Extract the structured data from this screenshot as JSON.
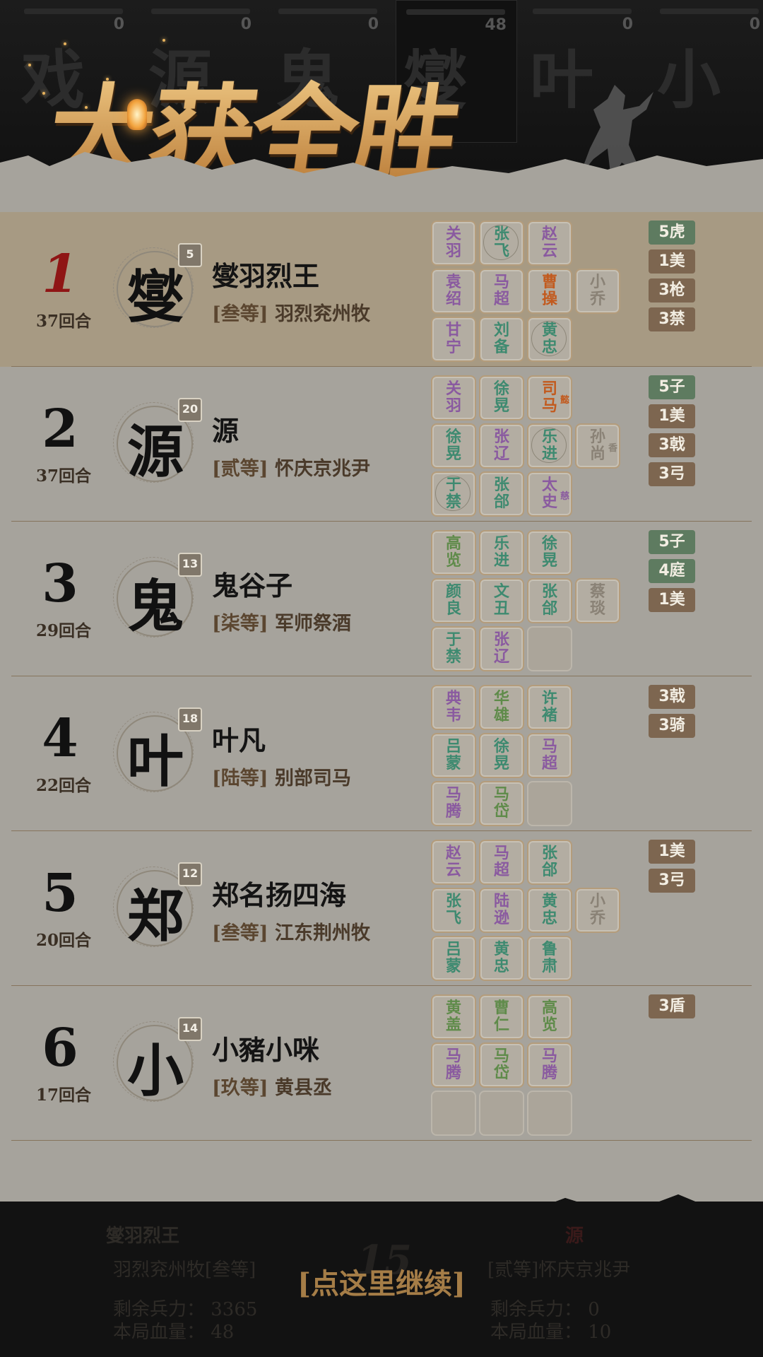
{
  "top_strip": {
    "players": [
      {
        "char": "戏",
        "score": "0"
      },
      {
        "char": "源",
        "score": "0"
      },
      {
        "char": "鬼",
        "score": "0"
      },
      {
        "char": "燮",
        "score": "48",
        "active": true
      },
      {
        "char": "叶",
        "score": "0"
      },
      {
        "char": "小",
        "score": "0"
      }
    ]
  },
  "banner": {
    "title": "大获全胜"
  },
  "rankings": [
    {
      "rank": "1",
      "rounds": "37回合",
      "avatar_char": "燮",
      "level": "5",
      "name": "燮羽烈王",
      "grade": "[叁等]",
      "title": "羽烈兖州牧",
      "cards": [
        {
          "t1": "关",
          "t2": "羽",
          "color": "purple"
        },
        {
          "t1": "张",
          "t2": "飞",
          "color": "green",
          "round": true
        },
        {
          "t1": "赵",
          "t2": "云",
          "color": "purple"
        },
        {
          "t1": "袁",
          "t2": "绍",
          "color": "purple"
        },
        {
          "t1": "马",
          "t2": "超",
          "color": "purple"
        },
        {
          "t1": "曹",
          "t2": "操",
          "color": "orange"
        },
        {
          "t1": "小",
          "t2": "乔",
          "color": "grey"
        },
        {
          "t1": "甘",
          "t2": "宁",
          "color": "purple"
        },
        {
          "t1": "刘",
          "t2": "备",
          "color": "green"
        },
        {
          "t1": "黄",
          "t2": "忠",
          "color": "green",
          "round": true
        }
      ],
      "tags": [
        {
          "text": "5虎",
          "color": "green"
        },
        {
          "text": "1美",
          "color": "brown"
        },
        {
          "text": "3枪",
          "color": "brown"
        },
        {
          "text": "3禁",
          "color": "brown"
        }
      ]
    },
    {
      "rank": "2",
      "rounds": "37回合",
      "avatar_char": "源",
      "level": "20",
      "name": "源",
      "grade": "[贰等]",
      "title": "怀庆京兆尹",
      "cards": [
        {
          "t1": "关",
          "t2": "羽",
          "color": "purple"
        },
        {
          "t1": "徐",
          "t2": "晃",
          "color": "green"
        },
        {
          "t1": "司",
          "t2": "马",
          "color": "orange",
          "sub": "懿"
        },
        {
          "t1": "徐",
          "t2": "晃",
          "color": "green"
        },
        {
          "t1": "张",
          "t2": "辽",
          "color": "purple"
        },
        {
          "t1": "乐",
          "t2": "进",
          "color": "green",
          "round": true
        },
        {
          "t1": "孙",
          "t2": "尚",
          "color": "grey",
          "sub": "香"
        },
        {
          "t1": "于",
          "t2": "禁",
          "color": "green",
          "round": true
        },
        {
          "t1": "张",
          "t2": "郃",
          "color": "green"
        },
        {
          "t1": "太",
          "t2": "史",
          "color": "purple",
          "sub": "慈"
        }
      ],
      "tags": [
        {
          "text": "5子",
          "color": "green"
        },
        {
          "text": "1美",
          "color": "brown"
        },
        {
          "text": "3戟",
          "color": "brown"
        },
        {
          "text": "3弓",
          "color": "brown"
        }
      ]
    },
    {
      "rank": "3",
      "rounds": "29回合",
      "avatar_char": "鬼",
      "level": "13",
      "name": "鬼谷子",
      "grade": "[柒等]",
      "title": "军师祭酒",
      "cards": [
        {
          "t1": "高",
          "t2": "览",
          "color": "olive"
        },
        {
          "t1": "乐",
          "t2": "进",
          "color": "green"
        },
        {
          "t1": "徐",
          "t2": "晃",
          "color": "green"
        },
        {
          "t1": "颜",
          "t2": "良",
          "color": "green"
        },
        {
          "t1": "文",
          "t2": "丑",
          "color": "green"
        },
        {
          "t1": "张",
          "t2": "郃",
          "color": "green"
        },
        {
          "t1": "蔡",
          "t2": "琰",
          "color": "grey"
        },
        {
          "t1": "于",
          "t2": "禁",
          "color": "green"
        },
        {
          "t1": "张",
          "t2": "辽",
          "color": "purple"
        },
        {
          "empty": true
        }
      ],
      "tags": [
        {
          "text": "5子",
          "color": "green"
        },
        {
          "text": "4庭",
          "color": "green"
        },
        {
          "text": "1美",
          "color": "brown"
        }
      ]
    },
    {
      "rank": "4",
      "rounds": "22回合",
      "avatar_char": "叶",
      "level": "18",
      "name": "叶凡",
      "grade": "[陆等]",
      "title": "别部司马",
      "cards": [
        {
          "t1": "典",
          "t2": "韦",
          "color": "purple"
        },
        {
          "t1": "华",
          "t2": "雄",
          "color": "olive"
        },
        {
          "t1": "许",
          "t2": "褚",
          "color": "green"
        },
        {
          "t1": "吕",
          "t2": "蒙",
          "color": "green"
        },
        {
          "t1": "徐",
          "t2": "晃",
          "color": "green"
        },
        {
          "t1": "马",
          "t2": "超",
          "color": "purple"
        },
        {
          "t1": "马",
          "t2": "腾",
          "color": "purple"
        },
        {
          "t1": "马",
          "t2": "岱",
          "color": "olive"
        },
        {
          "empty": true
        }
      ],
      "tags": [
        {
          "text": "3戟",
          "color": "brown"
        },
        {
          "text": "3骑",
          "color": "brown"
        }
      ]
    },
    {
      "rank": "5",
      "rounds": "20回合",
      "avatar_char": "郑",
      "level": "12",
      "name": "郑名扬四海",
      "grade": "[叁等]",
      "title": "江东荆州牧",
      "cards": [
        {
          "t1": "赵",
          "t2": "云",
          "color": "purple"
        },
        {
          "t1": "马",
          "t2": "超",
          "color": "purple"
        },
        {
          "t1": "张",
          "t2": "郃",
          "color": "green"
        },
        {
          "t1": "张",
          "t2": "飞",
          "color": "green"
        },
        {
          "t1": "陆",
          "t2": "逊",
          "color": "purple"
        },
        {
          "t1": "黄",
          "t2": "忠",
          "color": "green"
        },
        {
          "t1": "小",
          "t2": "乔",
          "color": "grey"
        },
        {
          "t1": "吕",
          "t2": "蒙",
          "color": "green"
        },
        {
          "t1": "黄",
          "t2": "忠",
          "color": "green"
        },
        {
          "t1": "鲁",
          "t2": "肃",
          "color": "green"
        }
      ],
      "tags": [
        {
          "text": "1美",
          "color": "brown"
        },
        {
          "text": "3弓",
          "color": "brown"
        }
      ]
    },
    {
      "rank": "6",
      "rounds": "17回合",
      "avatar_char": "小",
      "level": "14",
      "name": "小豬小咪",
      "grade": "[玖等]",
      "title": "黄县丞",
      "cards": [
        {
          "t1": "黄",
          "t2": "盖",
          "color": "olive"
        },
        {
          "t1": "曹",
          "t2": "仁",
          "color": "olive"
        },
        {
          "t1": "高",
          "t2": "览",
          "color": "olive"
        },
        {
          "t1": "马",
          "t2": "腾",
          "color": "purple"
        },
        {
          "t1": "马",
          "t2": "岱",
          "color": "olive"
        },
        {
          "t1": "马",
          "t2": "腾",
          "color": "purple"
        },
        {
          "empty": true
        },
        {
          "empty": true
        },
        {
          "empty": true
        }
      ],
      "tags": [
        {
          "text": "3盾",
          "color": "brown"
        }
      ]
    }
  ],
  "bottom": {
    "left_name": "燮羽烈王",
    "left_title": "羽烈兖州牧[叁等]",
    "left_troops": "剩余兵力： 3365",
    "left_hp": "本局血量： 48",
    "center_number": "15",
    "right_name": "源",
    "right_title": "[贰等]怀庆京兆尹",
    "right_troops": "剩余兵力： 0",
    "right_hp": "本局血量： 10",
    "continue_label": "[点这里继续]"
  },
  "colors": {
    "panel": "#a6a39c",
    "first_row": "#a79a83",
    "tag_green": "#5e7b60",
    "tag_brown": "#7d6650",
    "continue": "#a57d47"
  }
}
